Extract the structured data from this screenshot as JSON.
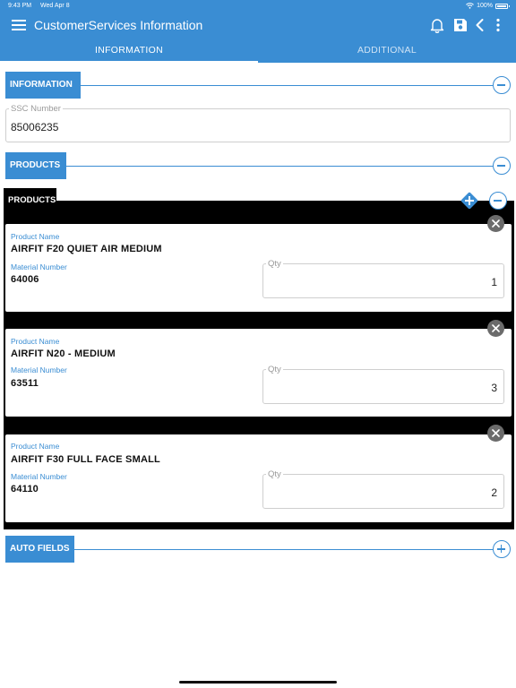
{
  "status_bar": {
    "time": "9:43 PM",
    "date": "Wed Apr 8",
    "battery": "100%"
  },
  "header": {
    "title": "CustomerServices Information"
  },
  "tabs": [
    {
      "label": "INFORMATION",
      "active": true
    },
    {
      "label": "ADDITIONAL",
      "active": false
    }
  ],
  "information": {
    "section_label": "INFORMATION",
    "ssc_label": "SSC Number",
    "ssc_value": "85006235"
  },
  "products_section": {
    "label": "PRODUCTS"
  },
  "products_list": {
    "label": "PRODUCTS",
    "items": [
      {
        "product_name_label": "Product Name",
        "product_name": "AIRFIT F20 QUIET AIR MEDIUM",
        "material_label": "Material Number",
        "material_number": "64006",
        "qty_label": "Qty",
        "qty": "1"
      },
      {
        "product_name_label": "Product Name",
        "product_name": "AIRFIT N20 - MEDIUM",
        "material_label": "Material Number",
        "material_number": "63511",
        "qty_label": "Qty",
        "qty": "3"
      },
      {
        "product_name_label": "Product Name",
        "product_name": "AIRFIT F30 FULL FACE SMALL",
        "material_label": "Material Number",
        "material_number": "64110",
        "qty_label": "Qty",
        "qty": "2"
      }
    ]
  },
  "auto_fields": {
    "label": "AUTO FIELDS"
  },
  "colors": {
    "accent": "#3a8dd3",
    "close_button": "#6b6b6b",
    "field_border": "#cfcfcf"
  },
  "icons": [
    "hamburger-menu-icon",
    "bell-icon",
    "save-icon",
    "back-chevron-icon",
    "more-vertical-icon",
    "collapse-minus-icon",
    "expand-plus-icon",
    "add-diamond-icon",
    "close-x-icon",
    "wifi-icon",
    "battery-icon"
  ]
}
